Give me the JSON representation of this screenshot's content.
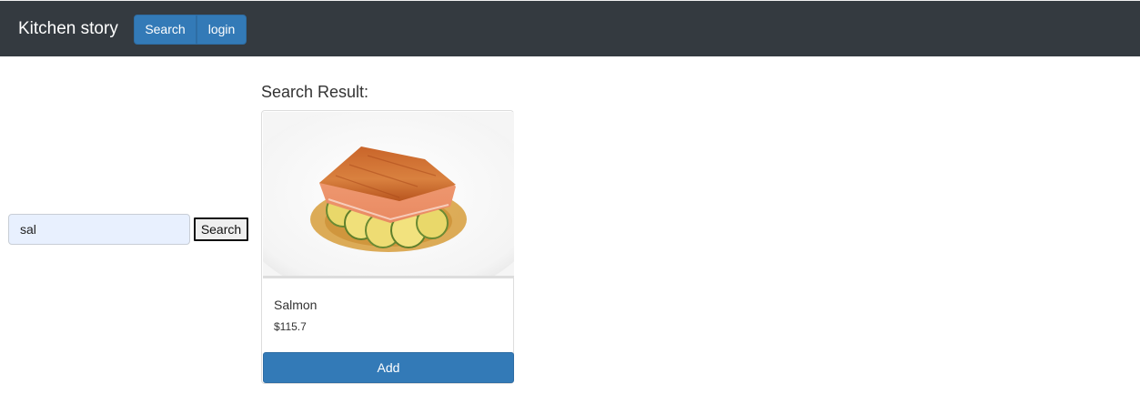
{
  "navbar": {
    "brand": "Kitchen story",
    "search_label": "Search",
    "login_label": "login"
  },
  "search": {
    "value": "sal",
    "submit_label": "Search"
  },
  "results": {
    "heading": "Search Result:",
    "items": [
      {
        "name": "Salmon",
        "price": "$115.7",
        "add_label": "Add",
        "image": "salmon-dish-photo"
      }
    ]
  },
  "colors": {
    "navbar_bg": "#343a40",
    "primary": "#337ab7",
    "input_bg": "#e8f0fe"
  }
}
